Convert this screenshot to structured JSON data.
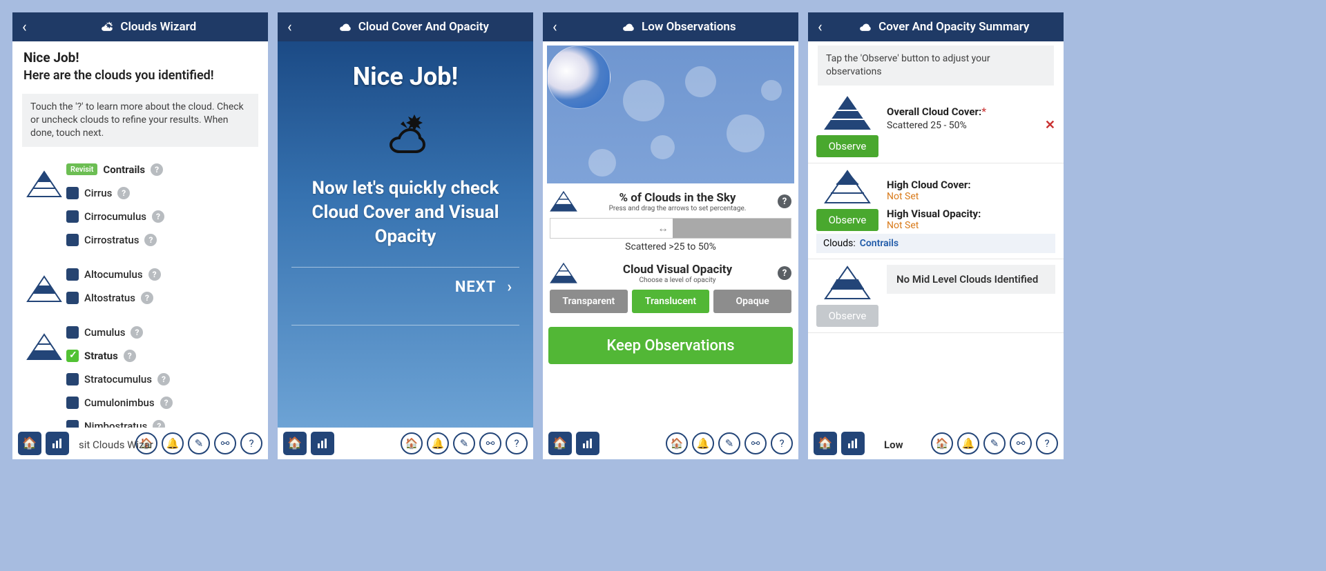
{
  "icons": {
    "wizard": "wand-cloud-icon"
  },
  "bottom_bar": {
    "home": "⌂",
    "chart": "▮▮",
    "home2": "⌂",
    "bell": "🔔",
    "wand": "✎",
    "link": "⚯",
    "help": "?"
  },
  "screen1": {
    "title": "Clouds Wizard",
    "nice": "Nice Job!",
    "sub": "Here are the clouds you identified!",
    "instructions": "Touch the '?' to learn more about the cloud. Check or uncheck clouds to refine your results. When done, touch next.",
    "revisit": "Revisit",
    "peek": "sit Clouds Wizar",
    "groups": [
      {
        "level": "high",
        "items": [
          {
            "name": "Contrails",
            "bold": true,
            "revisit": true,
            "checked": false
          },
          {
            "name": "Cirrus",
            "checked": false
          },
          {
            "name": "Cirrocumulus",
            "checked": false
          },
          {
            "name": "Cirrostratus",
            "checked": false
          }
        ]
      },
      {
        "level": "mid",
        "items": [
          {
            "name": "Altocumulus",
            "checked": false
          },
          {
            "name": "Altostratus",
            "checked": false
          }
        ]
      },
      {
        "level": "low",
        "items": [
          {
            "name": "Cumulus",
            "checked": false
          },
          {
            "name": "Stratus",
            "checked": true,
            "bold": true
          },
          {
            "name": "Stratocumulus",
            "checked": false
          },
          {
            "name": "Cumulonimbus",
            "checked": false
          },
          {
            "name": "Nimbostratus",
            "checked": false
          }
        ]
      }
    ]
  },
  "screen2": {
    "title": "Cloud Cover And Opacity",
    "nice": "Nice Job!",
    "msg": "Now let's quickly check Cloud Cover and Visual Opacity",
    "next": "NEXT"
  },
  "screen3": {
    "title": "Low Observations",
    "pct_title": "% of Clouds in the Sky",
    "pct_sub": "Press and drag the arrows to set percentage.",
    "pct_value": "Scattered >25 to 50%",
    "opacity_title": "Cloud Visual Opacity",
    "opacity_sub": "Choose a level of opacity",
    "opacity_options": [
      "Transparent",
      "Translucent",
      "Opaque"
    ],
    "opacity_selected": "Translucent",
    "keep": "Keep Observations"
  },
  "screen4": {
    "title": "Cover And Opacity Summary",
    "instructions": "Tap the 'Observe' button to adjust your observations",
    "observe": "Observe",
    "overall": {
      "label": "Overall Cloud Cover:",
      "value": "Scattered 25 - 50%",
      "required": true
    },
    "high": {
      "cover_label": "High Cloud Cover:",
      "cover_value": "Not Set",
      "opacity_label": "High Visual Opacity:",
      "opacity_value": "Not Set",
      "clouds_label": "Clouds:",
      "clouds_value": "Contrails"
    },
    "mid": {
      "msg": "No Mid Level Clouds Identified"
    },
    "low_peek": "Low"
  }
}
